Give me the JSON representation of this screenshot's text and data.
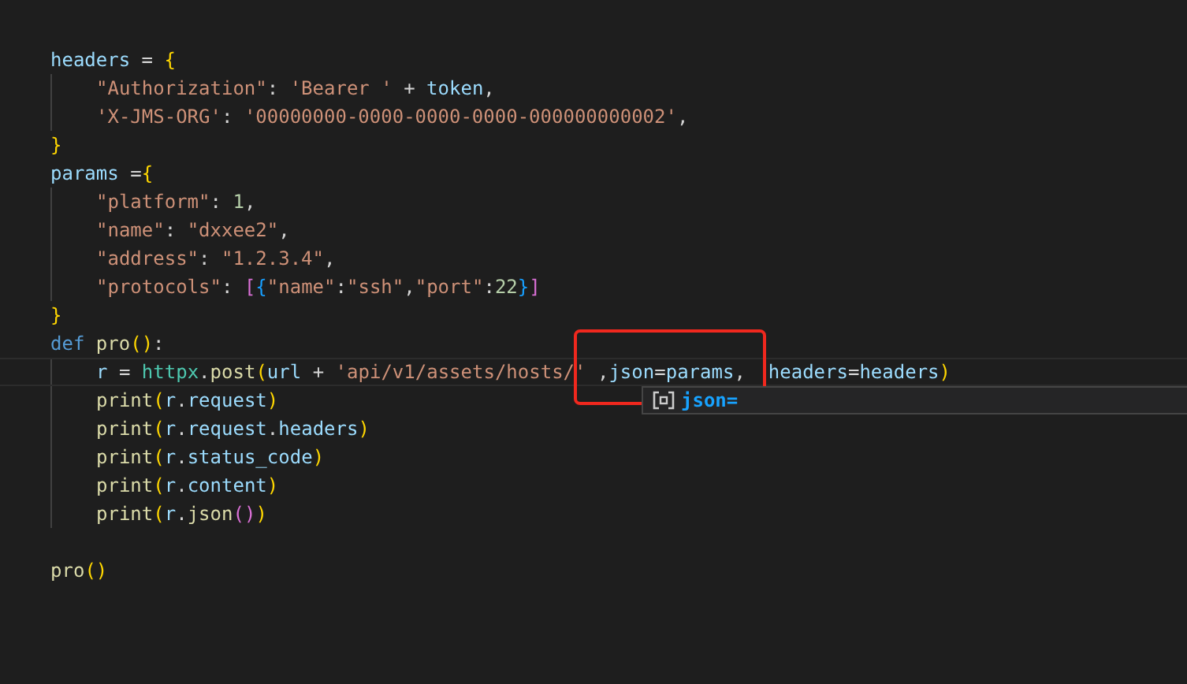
{
  "editor": {
    "lines": [
      {
        "current": false,
        "indented": false,
        "tokens": [
          {
            "kind": "variable",
            "text": "headers"
          },
          {
            "kind": "plain",
            "text": " = "
          },
          {
            "kind": "brace",
            "text": "{"
          }
        ]
      },
      {
        "current": false,
        "indented": true,
        "tokens": [
          {
            "kind": "string",
            "text": "\"Authorization\""
          },
          {
            "kind": "plain",
            "text": ": "
          },
          {
            "kind": "string",
            "text": "'Bearer '"
          },
          {
            "kind": "plain",
            "text": " + "
          },
          {
            "kind": "variable",
            "text": "token"
          },
          {
            "kind": "plain",
            "text": ","
          }
        ]
      },
      {
        "current": false,
        "indented": true,
        "tokens": [
          {
            "kind": "string",
            "text": "'X-JMS-ORG'"
          },
          {
            "kind": "plain",
            "text": ": "
          },
          {
            "kind": "string",
            "text": "'00000000-0000-0000-0000-000000000002'"
          },
          {
            "kind": "plain",
            "text": ","
          }
        ]
      },
      {
        "current": false,
        "indented": false,
        "tokens": [
          {
            "kind": "brace",
            "text": "}"
          }
        ]
      },
      {
        "current": false,
        "indented": false,
        "tokens": [
          {
            "kind": "variable",
            "text": "params"
          },
          {
            "kind": "plain",
            "text": " ="
          },
          {
            "kind": "brace",
            "text": "{"
          }
        ]
      },
      {
        "current": false,
        "indented": true,
        "tokens": [
          {
            "kind": "string",
            "text": "\"platform\""
          },
          {
            "kind": "plain",
            "text": ": "
          },
          {
            "kind": "number",
            "text": "1"
          },
          {
            "kind": "plain",
            "text": ","
          }
        ]
      },
      {
        "current": false,
        "indented": true,
        "tokens": [
          {
            "kind": "string",
            "text": "\"name\""
          },
          {
            "kind": "plain",
            "text": ": "
          },
          {
            "kind": "string",
            "text": "\"dxxee2\""
          },
          {
            "kind": "plain",
            "text": ","
          }
        ]
      },
      {
        "current": false,
        "indented": true,
        "tokens": [
          {
            "kind": "string",
            "text": "\"address\""
          },
          {
            "kind": "plain",
            "text": ": "
          },
          {
            "kind": "string",
            "text": "\"1.2.3.4\""
          },
          {
            "kind": "plain",
            "text": ","
          }
        ]
      },
      {
        "current": false,
        "indented": true,
        "tokens": [
          {
            "kind": "string",
            "text": "\"protocols\""
          },
          {
            "kind": "plain",
            "text": ": "
          },
          {
            "kind": "bracket2",
            "text": "["
          },
          {
            "kind": "bracket3",
            "text": "{"
          },
          {
            "kind": "string",
            "text": "\"name\""
          },
          {
            "kind": "plain",
            "text": ":"
          },
          {
            "kind": "string",
            "text": "\"ssh\""
          },
          {
            "kind": "plain",
            "text": ","
          },
          {
            "kind": "string",
            "text": "\"port\""
          },
          {
            "kind": "plain",
            "text": ":"
          },
          {
            "kind": "number",
            "text": "22"
          },
          {
            "kind": "bracket3",
            "text": "}"
          },
          {
            "kind": "bracket2",
            "text": "]"
          }
        ]
      },
      {
        "current": false,
        "indented": false,
        "tokens": [
          {
            "kind": "brace",
            "text": "}"
          }
        ]
      },
      {
        "current": false,
        "indented": false,
        "tokens": [
          {
            "kind": "keyword",
            "text": "def"
          },
          {
            "kind": "function",
            "text": "pro"
          },
          {
            "kind": "brace",
            "text": "()"
          },
          {
            "kind": "plain",
            "text": ":"
          }
        ]
      },
      {
        "current": true,
        "indented": true,
        "tokens": [
          {
            "kind": "variable",
            "text": "r"
          },
          {
            "kind": "plain",
            "text": " = "
          },
          {
            "kind": "class",
            "text": "httpx"
          },
          {
            "kind": "plain",
            "text": "."
          },
          {
            "kind": "function",
            "text": "post"
          },
          {
            "kind": "brace",
            "text": "("
          },
          {
            "kind": "variable",
            "text": "url"
          },
          {
            "kind": "plain",
            "text": " + "
          },
          {
            "kind": "string",
            "text": "'api/v1/assets/hosts/'"
          },
          {
            "kind": "plain",
            "text": " ,"
          },
          {
            "kind": "variable",
            "text": "json"
          },
          {
            "kind": "plain",
            "text": "="
          },
          {
            "kind": "variable",
            "text": "params"
          },
          {
            "kind": "plain",
            "text": ",  "
          },
          {
            "kind": "variable",
            "text": "headers"
          },
          {
            "kind": "plain",
            "text": "="
          },
          {
            "kind": "variable",
            "text": "headers"
          },
          {
            "kind": "brace",
            "text": ")"
          }
        ]
      },
      {
        "current": false,
        "indented": true,
        "tokens": [
          {
            "kind": "function",
            "text": "print"
          },
          {
            "kind": "brace",
            "text": "("
          },
          {
            "kind": "variable",
            "text": "r"
          },
          {
            "kind": "plain",
            "text": "."
          },
          {
            "kind": "variable",
            "text": "request"
          },
          {
            "kind": "brace",
            "text": ")"
          }
        ]
      },
      {
        "current": false,
        "indented": true,
        "tokens": [
          {
            "kind": "function",
            "text": "print"
          },
          {
            "kind": "brace",
            "text": "("
          },
          {
            "kind": "variable",
            "text": "r"
          },
          {
            "kind": "plain",
            "text": "."
          },
          {
            "kind": "variable",
            "text": "request"
          },
          {
            "kind": "plain",
            "text": "."
          },
          {
            "kind": "variable",
            "text": "headers"
          },
          {
            "kind": "brace",
            "text": ")"
          }
        ]
      },
      {
        "current": false,
        "indented": true,
        "tokens": [
          {
            "kind": "function",
            "text": "print"
          },
          {
            "kind": "brace",
            "text": "("
          },
          {
            "kind": "variable",
            "text": "r"
          },
          {
            "kind": "plain",
            "text": "."
          },
          {
            "kind": "variable",
            "text": "status_code"
          },
          {
            "kind": "brace",
            "text": ")"
          }
        ]
      },
      {
        "current": false,
        "indented": true,
        "tokens": [
          {
            "kind": "function",
            "text": "print"
          },
          {
            "kind": "brace",
            "text": "("
          },
          {
            "kind": "variable",
            "text": "r"
          },
          {
            "kind": "plain",
            "text": "."
          },
          {
            "kind": "variable",
            "text": "content"
          },
          {
            "kind": "brace",
            "text": ")"
          }
        ]
      },
      {
        "current": false,
        "indented": true,
        "tokens": [
          {
            "kind": "function",
            "text": "print"
          },
          {
            "kind": "brace",
            "text": "("
          },
          {
            "kind": "variable",
            "text": "r"
          },
          {
            "kind": "plain",
            "text": "."
          },
          {
            "kind": "function",
            "text": "json"
          },
          {
            "kind": "bracket2",
            "text": "()"
          },
          {
            "kind": "brace",
            "text": ")"
          }
        ]
      },
      {
        "current": false,
        "indented": false,
        "blank_before": true,
        "tokens": [
          {
            "kind": "function",
            "text": "pro"
          },
          {
            "kind": "brace",
            "text": "()"
          }
        ]
      }
    ]
  },
  "suggestion": {
    "label": "json="
  }
}
